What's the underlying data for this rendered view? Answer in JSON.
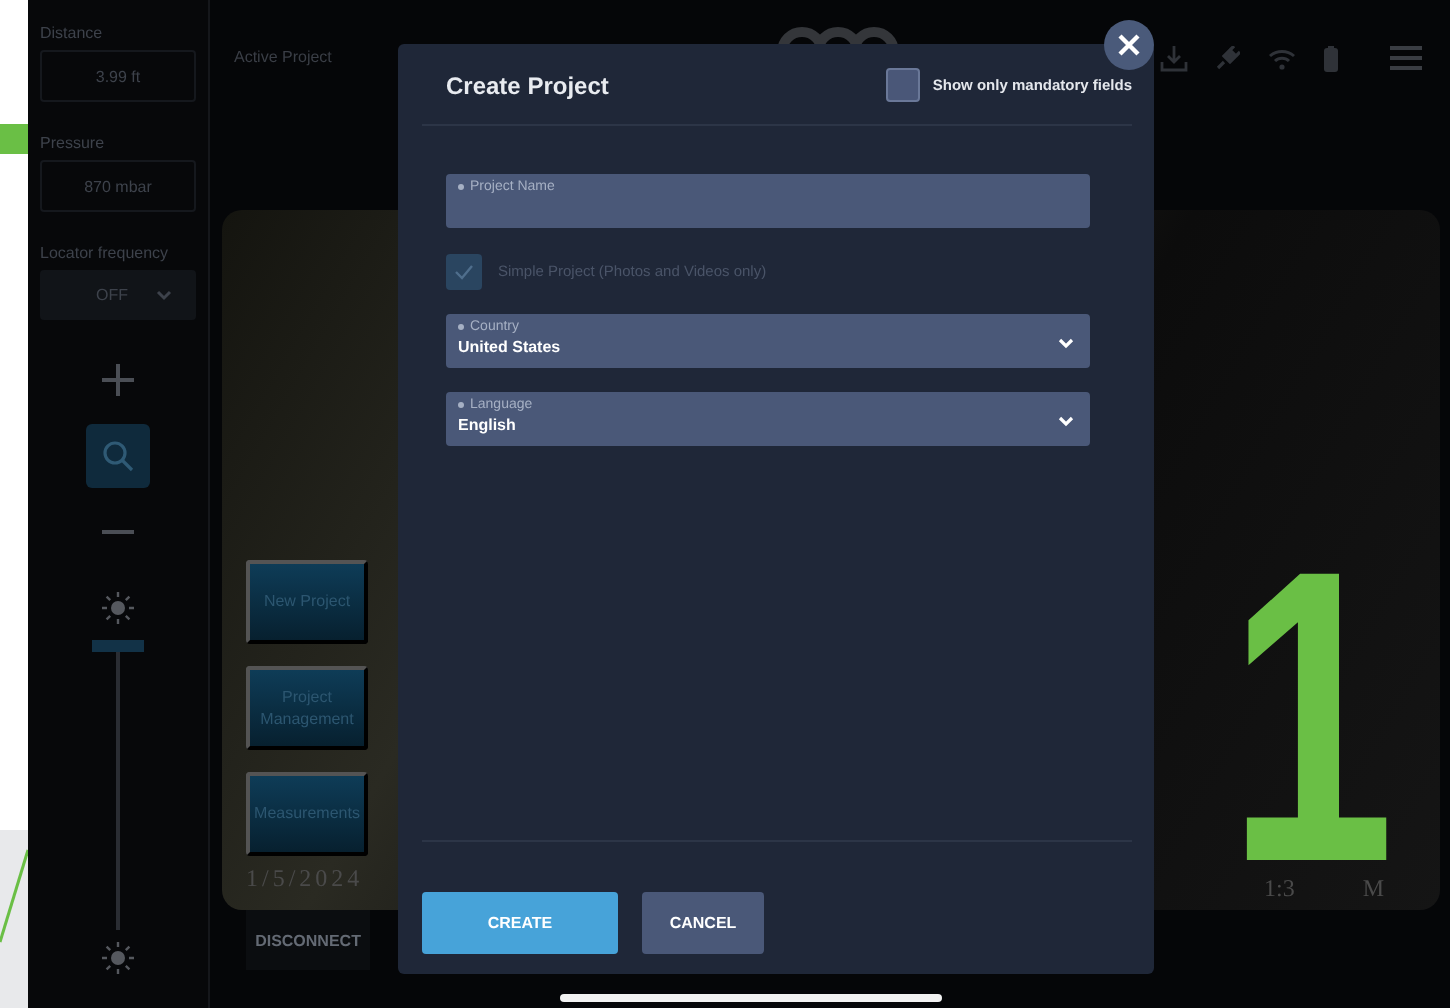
{
  "sidebar": {
    "readouts": [
      {
        "label": "Distance",
        "value": "3.99 ft"
      },
      {
        "label": "Pressure",
        "value": "870 mbar"
      }
    ],
    "locator_frequency": {
      "label": "Locator frequency",
      "value": "OFF"
    },
    "brightness": {
      "level": 1
    }
  },
  "top_bar": {
    "active_project_label": "Active Project"
  },
  "video": {
    "buttons": [
      "New Project",
      "Project Management",
      "Measurements"
    ],
    "date": "1/5/2024",
    "time_parts": [
      "1:3",
      "M"
    ]
  },
  "disconnect_button": "DISCONNECT",
  "dialog": {
    "title": "Create Project",
    "mandatory_only": {
      "label": "Show only mandatory fields",
      "checked": false
    },
    "fields": [
      {
        "kind": "text",
        "label": "Project Name",
        "required": true
      },
      {
        "kind": "checkbox",
        "label": "Simple Project (Photos and Videos only)",
        "checked": true,
        "disabled": true
      },
      {
        "kind": "select",
        "label": "Country",
        "required": true,
        "value": "United States"
      },
      {
        "kind": "select",
        "label": "Language",
        "required": true,
        "value": "English"
      }
    ],
    "buttons": [
      {
        "label": "CREATE",
        "kind": "primary"
      },
      {
        "label": "CANCEL",
        "kind": "secondary"
      }
    ]
  },
  "callout": {
    "number": "1"
  }
}
